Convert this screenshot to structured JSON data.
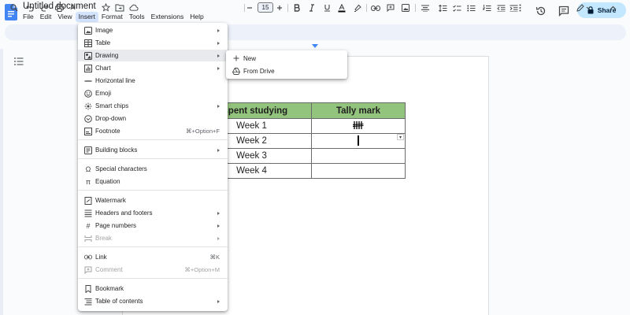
{
  "doc": {
    "title": "Untitled document"
  },
  "menubar": {
    "items": [
      "File",
      "Edit",
      "View",
      "Insert",
      "Format",
      "Tools",
      "Extensions",
      "Help"
    ],
    "active": "Insert"
  },
  "share_button": {
    "label": "Share"
  },
  "toolbar": {
    "font_size": "15"
  },
  "insert_menu": {
    "items": [
      {
        "label": "Image",
        "icon": "image-icon",
        "submenu": true
      },
      {
        "label": "Table",
        "icon": "table-icon",
        "submenu": true
      },
      {
        "label": "Drawing",
        "icon": "drawing-icon",
        "submenu": true,
        "highlighted": true
      },
      {
        "label": "Chart",
        "icon": "chart-icon",
        "submenu": true
      },
      {
        "label": "Horizontal line",
        "icon": "horizontal-line-icon"
      },
      {
        "label": "Emoji",
        "icon": "emoji-icon"
      },
      {
        "label": "Smart chips",
        "icon": "smart-chips-icon",
        "submenu": true
      },
      {
        "label": "Drop-down",
        "icon": "dropdown-icon"
      },
      {
        "label": "Footnote",
        "icon": "footnote-icon",
        "shortcut": "⌘+Option+F"
      },
      {
        "label": "Building blocks",
        "icon": "building-blocks-icon",
        "submenu": true
      },
      {
        "label": "Special characters",
        "icon": "omega-icon"
      },
      {
        "label": "Equation",
        "icon": "pi-icon"
      },
      {
        "label": "Watermark",
        "icon": "watermark-icon"
      },
      {
        "label": "Headers and footers",
        "icon": "headers-footers-icon",
        "submenu": true
      },
      {
        "label": "Page numbers",
        "icon": "hash-icon",
        "submenu": true
      },
      {
        "label": "Break",
        "icon": "break-icon",
        "submenu": true,
        "disabled": true
      },
      {
        "label": "Link",
        "icon": "link-icon",
        "shortcut": "⌘K"
      },
      {
        "label": "Comment",
        "icon": "comment-icon",
        "shortcut": "⌘+Option+M",
        "disabled": true
      },
      {
        "label": "Bookmark",
        "icon": "bookmark-icon"
      },
      {
        "label": "Table of contents",
        "icon": "table-of-contents-icon",
        "submenu": true
      }
    ]
  },
  "drawing_submenu": {
    "items": [
      {
        "label": "New",
        "icon": "plus-icon"
      },
      {
        "label": "From Drive",
        "icon": "drive-icon"
      }
    ]
  },
  "table": {
    "headers": [
      "s spent studying",
      "Tally mark"
    ],
    "rows": [
      {
        "week": "Week 1",
        "tally_count": 4
      },
      {
        "week": "Week 2",
        "tally_count": 1
      },
      {
        "week": "Week 3",
        "tally_count": 0
      },
      {
        "week": "Week 4",
        "tally_count": 0
      }
    ],
    "header_color": "#93c47d"
  },
  "colors": {
    "share_bg": "#c2e7ff",
    "menu_active_bg": "#d3e3fd",
    "toolbar_bg": "#edf2fa",
    "doc_blue": "#4285f4"
  }
}
